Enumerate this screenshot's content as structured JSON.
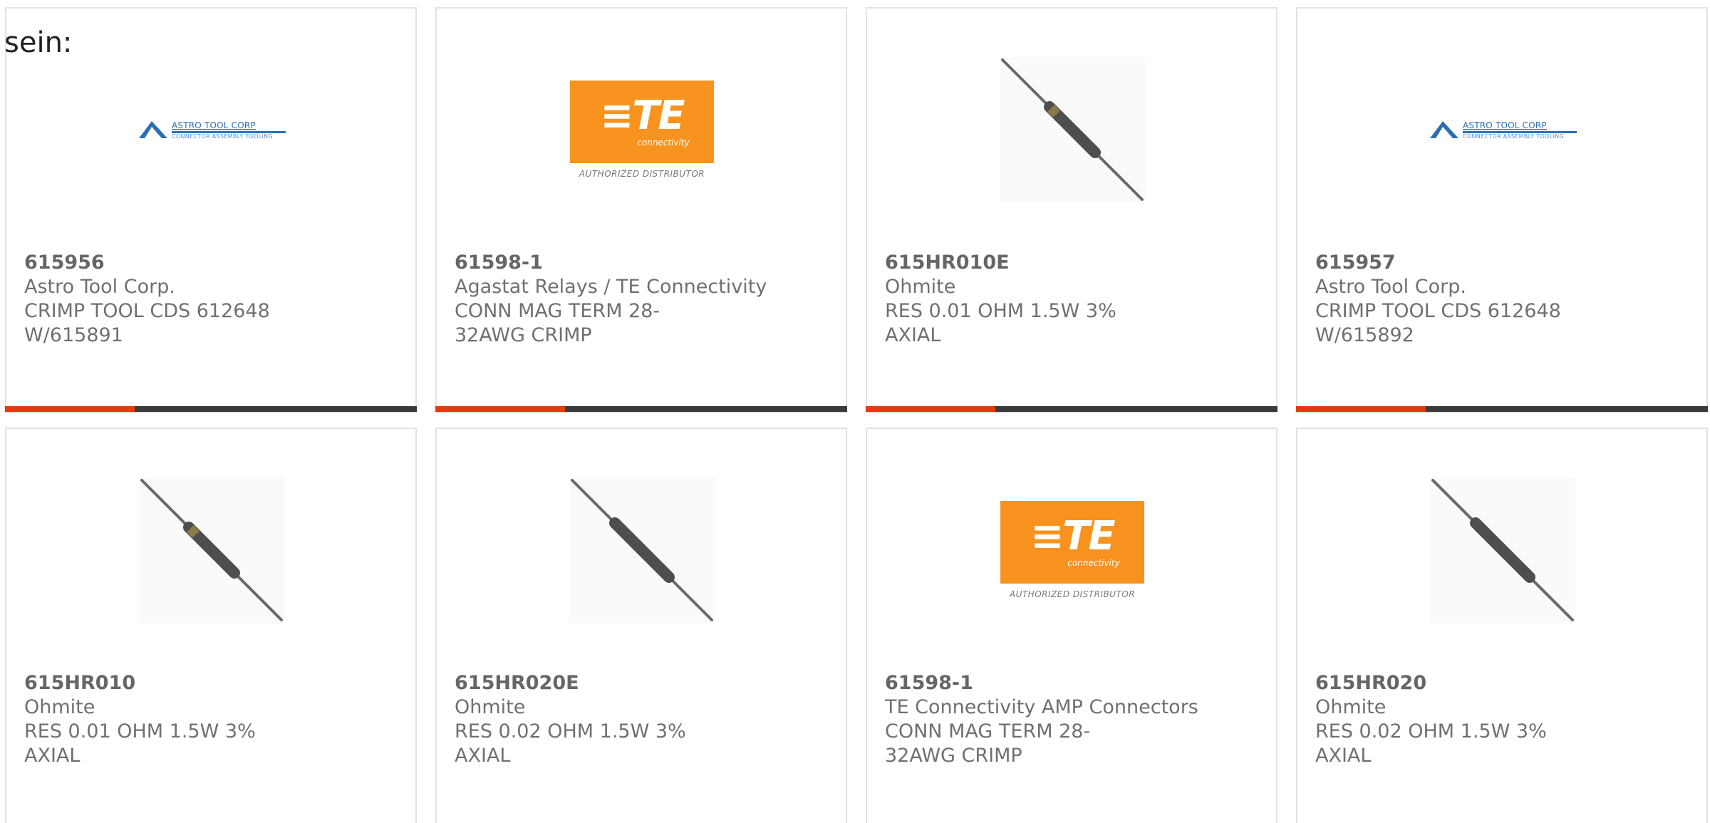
{
  "intro_text": "sein:",
  "colors": {
    "accent": "#e8380d",
    "bar": "#3a3a3a",
    "te_orange": "#f7931e",
    "astro_blue": "#2a6fb5"
  },
  "logos": {
    "te": {
      "mark": "≡TE",
      "sub": "connectivity",
      "auth": "AUTHORIZED DISTRIBUTOR"
    },
    "astro": {
      "name": "ASTRO TOOL CORP",
      "tag": "CONNECTOR ASSEMBLY TOOLING"
    }
  },
  "products": [
    {
      "part_number": "615956",
      "manufacturer": "Astro Tool Corp.",
      "description": "CRIMP TOOL CDS 612648 W/615891",
      "image": "astro-logo"
    },
    {
      "part_number": "61598-1",
      "manufacturer": "Agastat Relays / TE Connectivity",
      "description": "CONN MAG TERM 28-32AWG CRIMP",
      "image": "te-logo"
    },
    {
      "part_number": "615HR010E",
      "manufacturer": "Ohmite",
      "description": "RES 0.01 OHM 1.5W 3% AXIAL",
      "image": "axial-resistor"
    },
    {
      "part_number": "615957",
      "manufacturer": "Astro Tool Corp.",
      "description": "CRIMP TOOL CDS 612648 W/615892",
      "image": "astro-logo"
    },
    {
      "part_number": "615HR010",
      "manufacturer": "Ohmite",
      "description": "RES 0.01 OHM 1.5W 3% AXIAL",
      "image": "axial-resistor"
    },
    {
      "part_number": "615HR020E",
      "manufacturer": "Ohmite",
      "description": "RES 0.02 OHM 1.5W 3% AXIAL",
      "image": "axial-resistor"
    },
    {
      "part_number": "61598-1",
      "manufacturer": "TE Connectivity AMP Connectors",
      "description": "CONN MAG TERM 28-32AWG CRIMP",
      "image": "te-logo"
    },
    {
      "part_number": "615HR020",
      "manufacturer": "Ohmite",
      "description": "RES 0.02 OHM 1.5W 3% AXIAL",
      "image": "axial-resistor"
    }
  ]
}
